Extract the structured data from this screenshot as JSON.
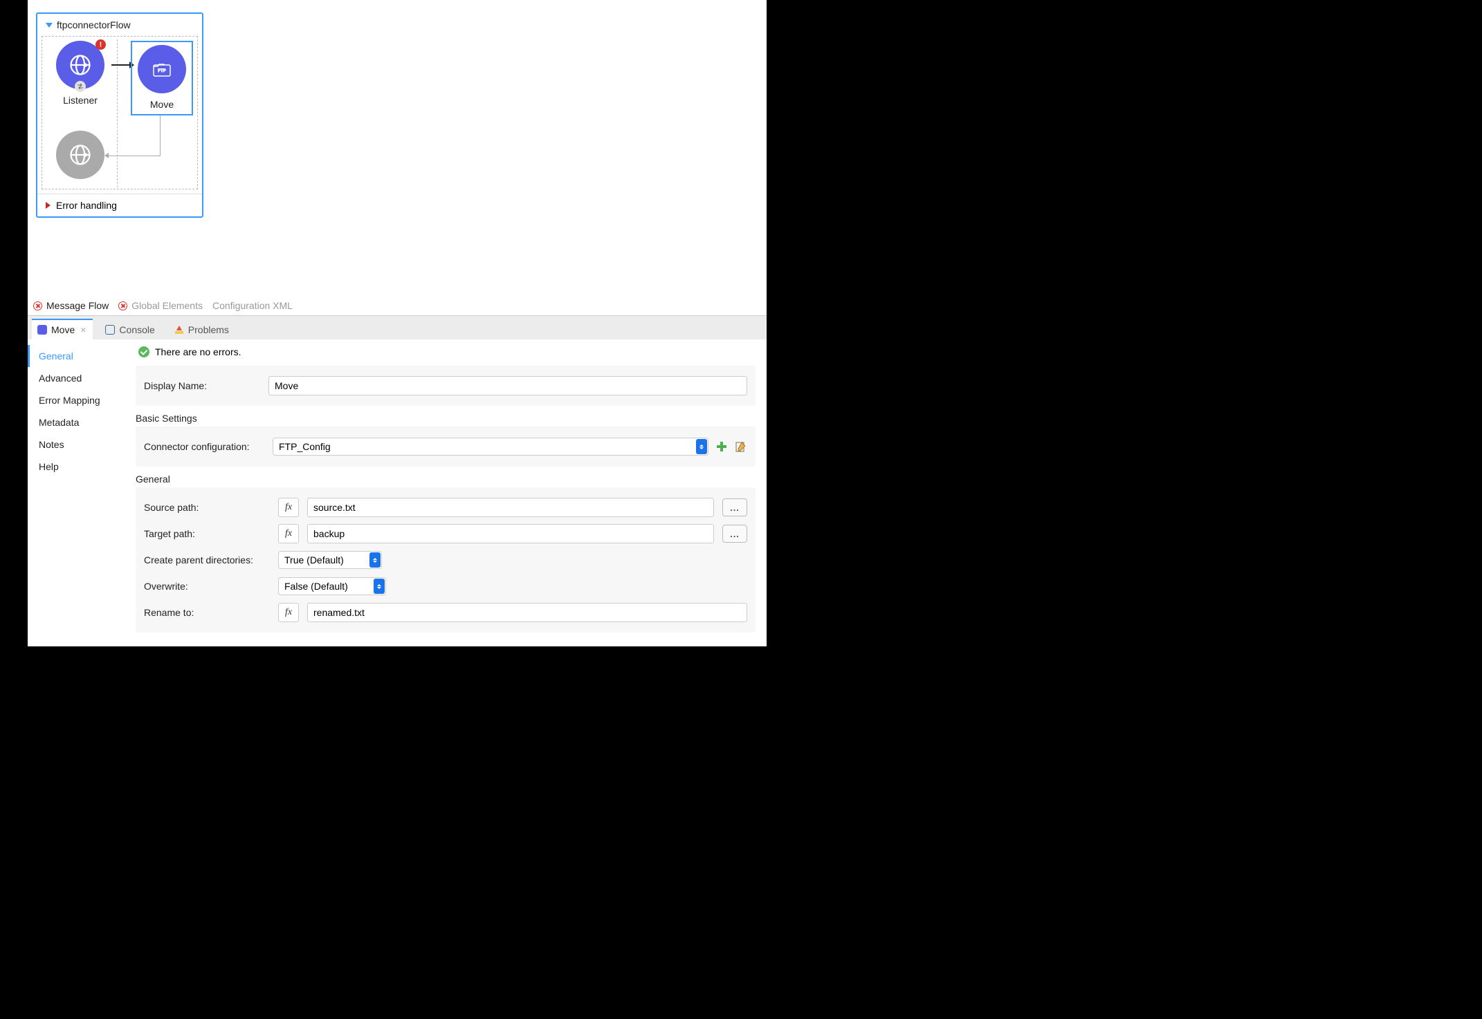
{
  "flow": {
    "title": "ftpconnectorFlow",
    "nodes": {
      "listener": "Listener",
      "move": "Move"
    },
    "error_handling": "Error handling"
  },
  "editor_tabs": {
    "message_flow": "Message Flow",
    "global_elements": "Global Elements",
    "config_xml": "Configuration XML"
  },
  "props_tabs": {
    "move": "Move",
    "console": "Console",
    "problems": "Problems"
  },
  "side_nav": {
    "general": "General",
    "advanced": "Advanced",
    "error_mapping": "Error Mapping",
    "metadata": "Metadata",
    "notes": "Notes",
    "help": "Help"
  },
  "status": {
    "no_errors": "There are no errors."
  },
  "form": {
    "display_name_label": "Display Name:",
    "display_name_value": "Move",
    "basic_settings": "Basic Settings",
    "connector_config_label": "Connector configuration:",
    "connector_config_value": "FTP_Config",
    "general_section": "General",
    "source_path_label": "Source path:",
    "source_path_value": "source.txt",
    "target_path_label": "Target path:",
    "target_path_value": "backup",
    "create_parent_label": "Create parent directories:",
    "create_parent_value": "True (Default)",
    "overwrite_label": "Overwrite:",
    "overwrite_value": "False (Default)",
    "rename_to_label": "Rename to:",
    "rename_to_value": "renamed.txt",
    "fx": "fx",
    "ellipsis": "..."
  }
}
